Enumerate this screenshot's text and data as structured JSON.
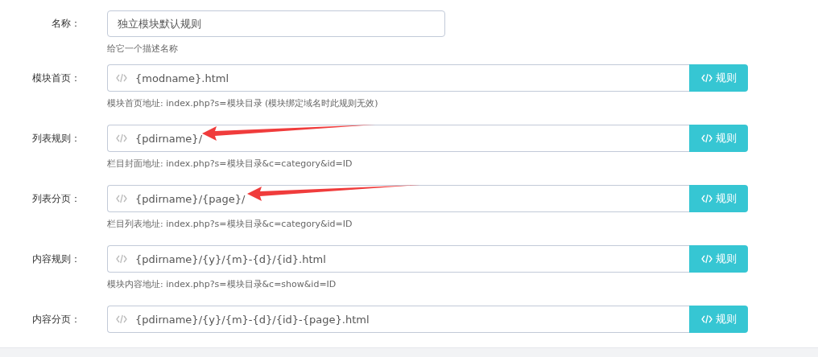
{
  "name_field": {
    "label": "名称：",
    "value": "独立模块默认规则",
    "help": "给它一个描述名称"
  },
  "rules": [
    {
      "label": "模块首页：",
      "value": "{modname}.html",
      "button": "规则",
      "help": "模块首页地址: index.php?s=模块目录 (模块绑定域名时此规则无效)",
      "arrow": false
    },
    {
      "label": "列表规则：",
      "value": "{pdirname}/",
      "button": "规则",
      "help": "栏目封面地址: index.php?s=模块目录&c=category&id=ID",
      "arrow": true
    },
    {
      "label": "列表分页：",
      "value": "{pdirname}/{page}/",
      "button": "规则",
      "help": "栏目列表地址: index.php?s=模块目录&c=category&id=ID",
      "arrow": true
    },
    {
      "label": "内容规则：",
      "value": "{pdirname}/{y}/{m}-{d}/{id}.html",
      "button": "规则",
      "help": "模块内容地址: index.php?s=模块目录&c=show&id=ID",
      "arrow": false
    },
    {
      "label": "内容分页：",
      "value": "{pdirname}/{y}/{m}-{d}/{id}-{page}.html",
      "button": "规则",
      "arrow": false
    }
  ]
}
